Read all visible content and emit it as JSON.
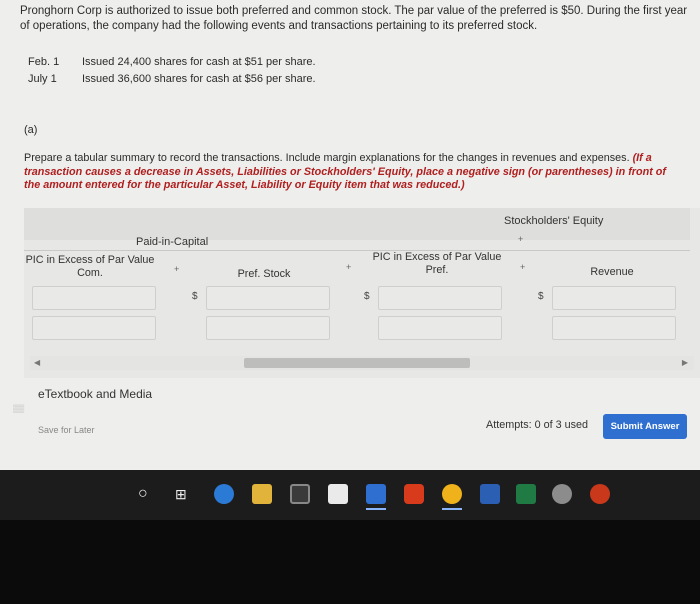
{
  "problem": {
    "text": "Pronghorn Corp is authorized to issue both preferred and common stock. The par value of the preferred is $50. During the first year of operations, the company had the following events and transactions pertaining to its preferred stock."
  },
  "transactions": [
    {
      "date": "Feb. 1",
      "desc": "Issued 24,400 shares for cash at $51 per share."
    },
    {
      "date": "July 1",
      "desc": "Issued 36,600 shares for cash at $56 per share."
    }
  ],
  "part": "(a)",
  "instructions": {
    "main": "Prepare a tabular summary to record the transactions. Include margin explanations for the changes in revenues and expenses.",
    "note": "(If a transaction causes a decrease in Assets, Liabilities or Stockholders' Equity, place a negative sign (or parentheses) in front of the amount entered for the particular Asset, Liability or Equity item that was reduced.)"
  },
  "table": {
    "group_header_se": "Stockholders' Equity",
    "group_header_pic": "Paid-in-Capital",
    "columns": [
      {
        "label_line1": "PIC in Excess of Par Value",
        "label_line2": "Com."
      },
      {
        "label_line1": "Pref. Stock",
        "label_line2": ""
      },
      {
        "label_line1": "PIC in Excess of Par Value",
        "label_line2": "Pref."
      },
      {
        "label_line1": "Revenue",
        "label_line2": ""
      }
    ],
    "plus_sign": "+",
    "dollar_sign": "$"
  },
  "links": {
    "etextbook": "eTextbook and Media"
  },
  "buttons": {
    "save_later": "Save for Later",
    "submit": "Submit Answer"
  },
  "attempts": "Attempts: 0 of 3 used",
  "colors": {
    "submit": "#2f6fd0",
    "note_red": "#b01f1f",
    "taskbar": "#1c1c1c"
  },
  "taskbar_icons": [
    "search-circle-icon",
    "task-view-icon",
    "edge-icon",
    "file-explorer-icon",
    "calculator-icon",
    "store-icon",
    "mail-icon",
    "office-icon",
    "chrome-icon",
    "word-icon",
    "excel-icon",
    "photos-icon",
    "powerpoint-icon"
  ]
}
